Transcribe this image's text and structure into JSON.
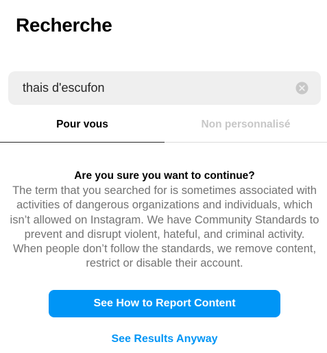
{
  "header": {
    "title": "Recherche"
  },
  "search": {
    "value": "thais d'escufon",
    "clear_icon": "circle-x-icon"
  },
  "tabs": [
    {
      "label": "Pour vous",
      "active": true
    },
    {
      "label": "Non personnalisé",
      "active": false
    }
  ],
  "warning": {
    "title": "Are you sure you want to continue?",
    "body": "The term that you searched for is sometimes associated with activities of dangerous organizations and individuals, which isn’t allowed on Instagram. We have Community Standards to prevent and disrupt violent, hateful, and criminal activity. When people don’t follow the standards, we remove content, restrict or disable their account."
  },
  "actions": {
    "primary_label": "See How to Report Content",
    "secondary_label": "See Results Anyway"
  },
  "colors": {
    "accent": "#0095f6",
    "search_background": "#efefef",
    "secondary_text": "#737373",
    "inactive_tab": "#c7c7c7"
  }
}
